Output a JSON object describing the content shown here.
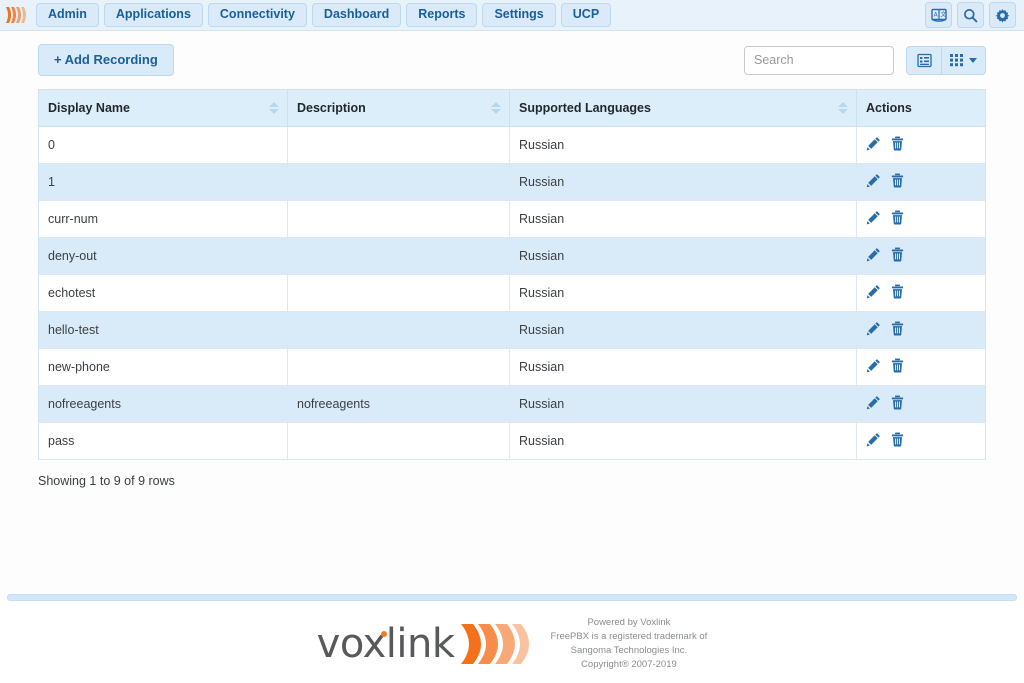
{
  "brand": {
    "logo_icon": "voxlink-wave-logo",
    "accent_orange": "#f47b20",
    "accent_blue": "#1a5e9a"
  },
  "nav": {
    "items": [
      {
        "label": "Admin",
        "name": "nav-admin"
      },
      {
        "label": "Applications",
        "name": "nav-applications"
      },
      {
        "label": "Connectivity",
        "name": "nav-connectivity"
      },
      {
        "label": "Dashboard",
        "name": "nav-dashboard"
      },
      {
        "label": "Reports",
        "name": "nav-reports"
      },
      {
        "label": "Settings",
        "name": "nav-settings"
      },
      {
        "label": "UCP",
        "name": "nav-ucp"
      }
    ],
    "right_icons": [
      {
        "name": "language-icon",
        "title": "Language"
      },
      {
        "name": "search-icon",
        "title": "Search"
      },
      {
        "name": "gear-icon",
        "title": "Settings"
      }
    ]
  },
  "toolbar": {
    "add_label": "Add Recording",
    "add_plus": "+",
    "search_placeholder": "Search",
    "search_value": "",
    "view_list_icon": "list-view-icon",
    "columns_icon": "grid-columns-icon"
  },
  "table": {
    "columns": [
      {
        "label": "Display Name",
        "sortable": true
      },
      {
        "label": "Description",
        "sortable": true
      },
      {
        "label": "Supported Languages",
        "sortable": true
      },
      {
        "label": "Actions",
        "sortable": false
      }
    ],
    "rows": [
      {
        "display_name": "0",
        "description": "",
        "languages": "Russian"
      },
      {
        "display_name": "1",
        "description": "",
        "languages": "Russian"
      },
      {
        "display_name": "curr-num",
        "description": "",
        "languages": "Russian"
      },
      {
        "display_name": "deny-out",
        "description": "",
        "languages": "Russian"
      },
      {
        "display_name": "echotest",
        "description": "",
        "languages": "Russian"
      },
      {
        "display_name": "hello-test",
        "description": "",
        "languages": "Russian"
      },
      {
        "display_name": "new-phone",
        "description": "",
        "languages": "Russian"
      },
      {
        "display_name": "nofreeagents",
        "description": "nofreeagents",
        "languages": "Russian"
      },
      {
        "display_name": "pass",
        "description": "",
        "languages": "Russian"
      }
    ],
    "actions": [
      {
        "name": "edit-icon",
        "title": "Edit"
      },
      {
        "name": "delete-icon",
        "title": "Delete"
      }
    ],
    "showing_text": "Showing 1 to 9 of 9 rows"
  },
  "footer": {
    "logo_word": "voxlink",
    "line1": "Powered by Voxlink",
    "line2": "FreePBX is a registered trademark of",
    "line3": "Sangoma Technologies Inc.",
    "line4": "Copyright® 2007-2019"
  }
}
